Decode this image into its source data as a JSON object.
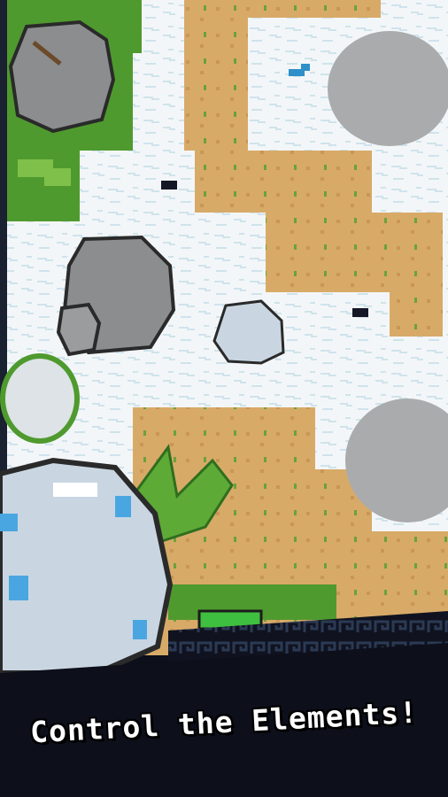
{
  "banner": {
    "caption": "Control the Elements!"
  },
  "colors": {
    "snow": "#f3f6f8",
    "snow_crack": "#b9d8e6",
    "sand": "#d8aa68",
    "grass": "#4f9a2e",
    "grass_light": "#7fc04a",
    "rock": "#8b8d8f",
    "rock_light": "#a9abad",
    "outline": "#2a2a2a",
    "ice": "#c9d6e2",
    "ice_blue": "#4aa6e0",
    "border_dark": "#10131f",
    "border_pattern": "#2b3a55"
  }
}
